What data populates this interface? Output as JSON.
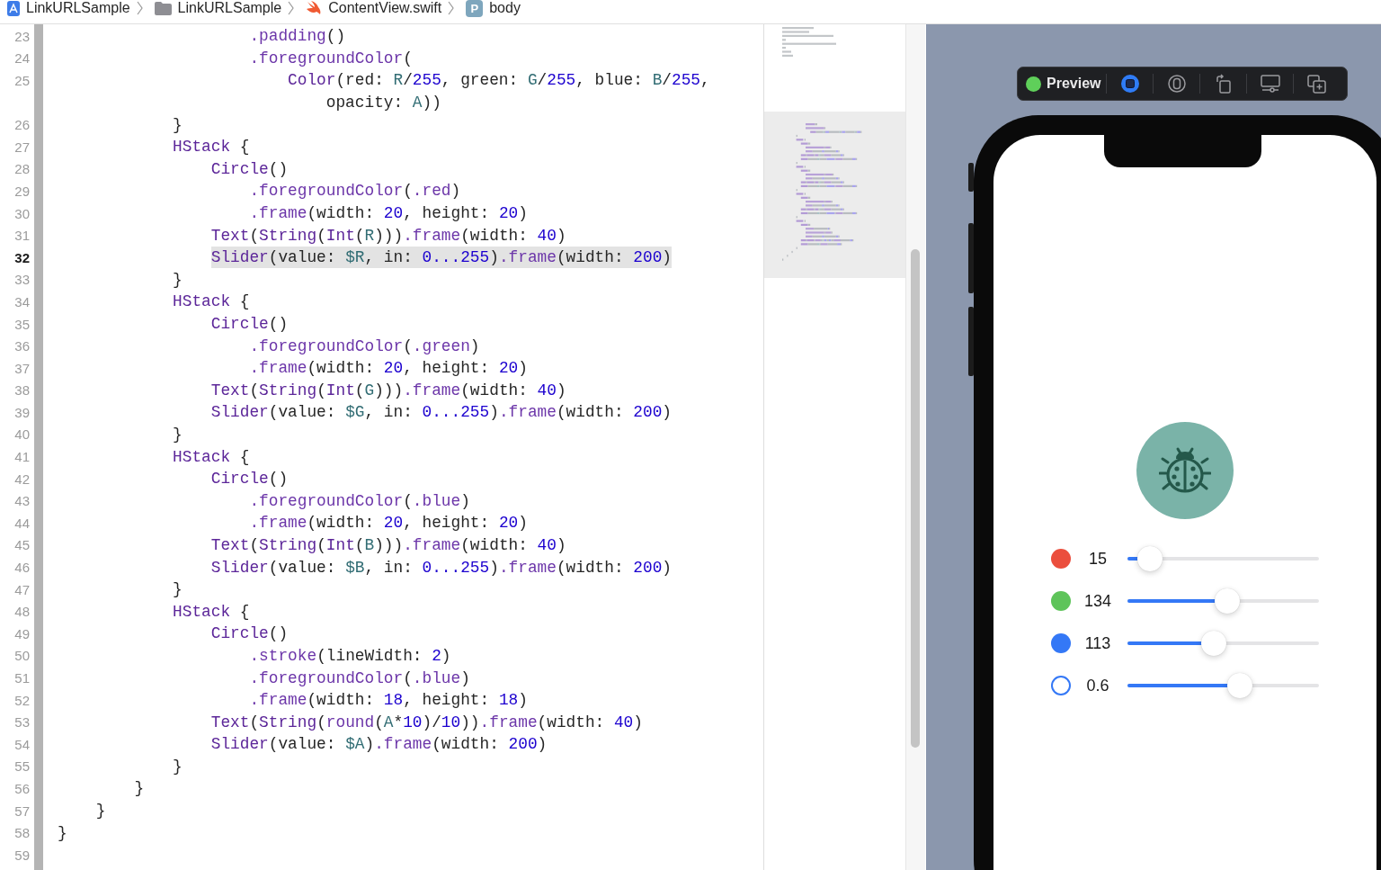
{
  "breadcrumb": [
    {
      "kind": "app",
      "label": "LinkURLSample"
    },
    {
      "kind": "folder",
      "label": "LinkURLSample"
    },
    {
      "kind": "swift",
      "label": "ContentView.swift"
    },
    {
      "kind": "property",
      "badge": "P",
      "label": "body"
    }
  ],
  "editor": {
    "lines": [
      {
        "number": "23",
        "current": false,
        "segments": [
          {
            "kind": "member",
            "text": "                    .padding"
          },
          {
            "kind": "plain",
            "text": "()"
          }
        ]
      },
      {
        "number": "24",
        "current": false,
        "segments": [
          {
            "kind": "member",
            "text": "                    .foregroundColor"
          },
          {
            "kind": "plain",
            "text": "("
          }
        ]
      },
      {
        "number": "25",
        "current": false,
        "segments": [
          {
            "kind": "type",
            "text": "                        Color"
          },
          {
            "kind": "plain",
            "text": "(red: "
          },
          {
            "kind": "variable",
            "text": "R"
          },
          {
            "kind": "plain",
            "text": "/"
          },
          {
            "kind": "number",
            "text": "255"
          },
          {
            "kind": "plain",
            "text": ", green: "
          },
          {
            "kind": "variable",
            "text": "G"
          },
          {
            "kind": "plain",
            "text": "/"
          },
          {
            "kind": "number",
            "text": "255"
          },
          {
            "kind": "plain",
            "text": ", blue: "
          },
          {
            "kind": "variable",
            "text": "B"
          },
          {
            "kind": "plain",
            "text": "/"
          },
          {
            "kind": "number",
            "text": "255"
          },
          {
            "kind": "plain",
            "text": ","
          }
        ],
        "continued": [
          {
            "kind": "plain",
            "text": "                            opacity: "
          },
          {
            "kind": "variable",
            "text": "A"
          },
          {
            "kind": "plain",
            "text": "))"
          }
        ]
      },
      {
        "number": "26",
        "current": false,
        "segments": [
          {
            "kind": "plain",
            "text": "            }"
          }
        ]
      },
      {
        "number": "27",
        "current": false,
        "segments": [
          {
            "kind": "type",
            "text": "            HStack"
          },
          {
            "kind": "plain",
            "text": " {"
          }
        ]
      },
      {
        "number": "28",
        "current": false,
        "segments": [
          {
            "kind": "type",
            "text": "                Circle"
          },
          {
            "kind": "plain",
            "text": "()"
          }
        ]
      },
      {
        "number": "29",
        "current": false,
        "segments": [
          {
            "kind": "member",
            "text": "                    .foregroundColor"
          },
          {
            "kind": "plain",
            "text": "("
          },
          {
            "kind": "member",
            "text": ".red"
          },
          {
            "kind": "plain",
            "text": ")"
          }
        ]
      },
      {
        "number": "30",
        "current": false,
        "segments": [
          {
            "kind": "member",
            "text": "                    .frame"
          },
          {
            "kind": "plain",
            "text": "(width: "
          },
          {
            "kind": "number",
            "text": "20"
          },
          {
            "kind": "plain",
            "text": ", height: "
          },
          {
            "kind": "number",
            "text": "20"
          },
          {
            "kind": "plain",
            "text": ")"
          }
        ]
      },
      {
        "number": "31",
        "current": false,
        "segments": [
          {
            "kind": "type",
            "text": "                Text"
          },
          {
            "kind": "plain",
            "text": "("
          },
          {
            "kind": "type",
            "text": "String"
          },
          {
            "kind": "plain",
            "text": "("
          },
          {
            "kind": "type",
            "text": "Int"
          },
          {
            "kind": "plain",
            "text": "("
          },
          {
            "kind": "variable",
            "text": "R"
          },
          {
            "kind": "plain",
            "text": ")))"
          },
          {
            "kind": "member",
            "text": ".frame"
          },
          {
            "kind": "plain",
            "text": "(width: "
          },
          {
            "kind": "number",
            "text": "40"
          },
          {
            "kind": "plain",
            "text": ")"
          }
        ]
      },
      {
        "number": "32",
        "current": true,
        "segments": [
          {
            "kind": "type",
            "text": "                Slider"
          },
          {
            "kind": "plain",
            "text": "(value: "
          },
          {
            "kind": "variable",
            "text": "$R"
          },
          {
            "kind": "plain",
            "text": ", in: "
          },
          {
            "kind": "number",
            "text": "0...255"
          },
          {
            "kind": "plain",
            "text": ")"
          },
          {
            "kind": "member",
            "text": ".frame"
          },
          {
            "kind": "plain",
            "text": "(width: "
          },
          {
            "kind": "number",
            "text": "200"
          },
          {
            "kind": "plain",
            "text": ")"
          }
        ]
      },
      {
        "number": "33",
        "current": false,
        "segments": [
          {
            "kind": "plain",
            "text": "            }"
          }
        ]
      },
      {
        "number": "34",
        "current": false,
        "segments": [
          {
            "kind": "type",
            "text": "            HStack"
          },
          {
            "kind": "plain",
            "text": " {"
          }
        ]
      },
      {
        "number": "35",
        "current": false,
        "segments": [
          {
            "kind": "type",
            "text": "                Circle"
          },
          {
            "kind": "plain",
            "text": "()"
          }
        ]
      },
      {
        "number": "36",
        "current": false,
        "segments": [
          {
            "kind": "member",
            "text": "                    .foregroundColor"
          },
          {
            "kind": "plain",
            "text": "("
          },
          {
            "kind": "member",
            "text": ".green"
          },
          {
            "kind": "plain",
            "text": ")"
          }
        ]
      },
      {
        "number": "37",
        "current": false,
        "segments": [
          {
            "kind": "member",
            "text": "                    .frame"
          },
          {
            "kind": "plain",
            "text": "(width: "
          },
          {
            "kind": "number",
            "text": "20"
          },
          {
            "kind": "plain",
            "text": ", height: "
          },
          {
            "kind": "number",
            "text": "20"
          },
          {
            "kind": "plain",
            "text": ")"
          }
        ]
      },
      {
        "number": "38",
        "current": false,
        "segments": [
          {
            "kind": "type",
            "text": "                Text"
          },
          {
            "kind": "plain",
            "text": "("
          },
          {
            "kind": "type",
            "text": "String"
          },
          {
            "kind": "plain",
            "text": "("
          },
          {
            "kind": "type",
            "text": "Int"
          },
          {
            "kind": "plain",
            "text": "("
          },
          {
            "kind": "variable",
            "text": "G"
          },
          {
            "kind": "plain",
            "text": ")))"
          },
          {
            "kind": "member",
            "text": ".frame"
          },
          {
            "kind": "plain",
            "text": "(width: "
          },
          {
            "kind": "number",
            "text": "40"
          },
          {
            "kind": "plain",
            "text": ")"
          }
        ]
      },
      {
        "number": "39",
        "current": false,
        "segments": [
          {
            "kind": "type",
            "text": "                Slider"
          },
          {
            "kind": "plain",
            "text": "(value: "
          },
          {
            "kind": "variable",
            "text": "$G"
          },
          {
            "kind": "plain",
            "text": ", in: "
          },
          {
            "kind": "number",
            "text": "0...255"
          },
          {
            "kind": "plain",
            "text": ")"
          },
          {
            "kind": "member",
            "text": ".frame"
          },
          {
            "kind": "plain",
            "text": "(width: "
          },
          {
            "kind": "number",
            "text": "200"
          },
          {
            "kind": "plain",
            "text": ")"
          }
        ]
      },
      {
        "number": "40",
        "current": false,
        "segments": [
          {
            "kind": "plain",
            "text": "            }"
          }
        ]
      },
      {
        "number": "41",
        "current": false,
        "segments": [
          {
            "kind": "type",
            "text": "            HStack"
          },
          {
            "kind": "plain",
            "text": " {"
          }
        ]
      },
      {
        "number": "42",
        "current": false,
        "segments": [
          {
            "kind": "type",
            "text": "                Circle"
          },
          {
            "kind": "plain",
            "text": "()"
          }
        ]
      },
      {
        "number": "43",
        "current": false,
        "segments": [
          {
            "kind": "member",
            "text": "                    .foregroundColor"
          },
          {
            "kind": "plain",
            "text": "("
          },
          {
            "kind": "member",
            "text": ".blue"
          },
          {
            "kind": "plain",
            "text": ")"
          }
        ]
      },
      {
        "number": "44",
        "current": false,
        "segments": [
          {
            "kind": "member",
            "text": "                    .frame"
          },
          {
            "kind": "plain",
            "text": "(width: "
          },
          {
            "kind": "number",
            "text": "20"
          },
          {
            "kind": "plain",
            "text": ", height: "
          },
          {
            "kind": "number",
            "text": "20"
          },
          {
            "kind": "plain",
            "text": ")"
          }
        ]
      },
      {
        "number": "45",
        "current": false,
        "segments": [
          {
            "kind": "type",
            "text": "                Text"
          },
          {
            "kind": "plain",
            "text": "("
          },
          {
            "kind": "type",
            "text": "String"
          },
          {
            "kind": "plain",
            "text": "("
          },
          {
            "kind": "type",
            "text": "Int"
          },
          {
            "kind": "plain",
            "text": "("
          },
          {
            "kind": "variable",
            "text": "B"
          },
          {
            "kind": "plain",
            "text": ")))"
          },
          {
            "kind": "member",
            "text": ".frame"
          },
          {
            "kind": "plain",
            "text": "(width: "
          },
          {
            "kind": "number",
            "text": "40"
          },
          {
            "kind": "plain",
            "text": ")"
          }
        ]
      },
      {
        "number": "46",
        "current": false,
        "segments": [
          {
            "kind": "type",
            "text": "                Slider"
          },
          {
            "kind": "plain",
            "text": "(value: "
          },
          {
            "kind": "variable",
            "text": "$B"
          },
          {
            "kind": "plain",
            "text": ", in: "
          },
          {
            "kind": "number",
            "text": "0...255"
          },
          {
            "kind": "plain",
            "text": ")"
          },
          {
            "kind": "member",
            "text": ".frame"
          },
          {
            "kind": "plain",
            "text": "(width: "
          },
          {
            "kind": "number",
            "text": "200"
          },
          {
            "kind": "plain",
            "text": ")"
          }
        ]
      },
      {
        "number": "47",
        "current": false,
        "segments": [
          {
            "kind": "plain",
            "text": "            }"
          }
        ]
      },
      {
        "number": "48",
        "current": false,
        "segments": [
          {
            "kind": "type",
            "text": "            HStack"
          },
          {
            "kind": "plain",
            "text": " {"
          }
        ]
      },
      {
        "number": "49",
        "current": false,
        "segments": [
          {
            "kind": "type",
            "text": "                Circle"
          },
          {
            "kind": "plain",
            "text": "()"
          }
        ]
      },
      {
        "number": "50",
        "current": false,
        "segments": [
          {
            "kind": "member",
            "text": "                    .stroke"
          },
          {
            "kind": "plain",
            "text": "(lineWidth: "
          },
          {
            "kind": "number",
            "text": "2"
          },
          {
            "kind": "plain",
            "text": ")"
          }
        ]
      },
      {
        "number": "51",
        "current": false,
        "segments": [
          {
            "kind": "member",
            "text": "                    .foregroundColor"
          },
          {
            "kind": "plain",
            "text": "("
          },
          {
            "kind": "member",
            "text": ".blue"
          },
          {
            "kind": "plain",
            "text": ")"
          }
        ]
      },
      {
        "number": "52",
        "current": false,
        "segments": [
          {
            "kind": "member",
            "text": "                    .frame"
          },
          {
            "kind": "plain",
            "text": "(width: "
          },
          {
            "kind": "number",
            "text": "18"
          },
          {
            "kind": "plain",
            "text": ", height: "
          },
          {
            "kind": "number",
            "text": "18"
          },
          {
            "kind": "plain",
            "text": ")"
          }
        ]
      },
      {
        "number": "53",
        "current": false,
        "segments": [
          {
            "kind": "type",
            "text": "                Text"
          },
          {
            "kind": "plain",
            "text": "("
          },
          {
            "kind": "type",
            "text": "String"
          },
          {
            "kind": "plain",
            "text": "("
          },
          {
            "kind": "member",
            "text": "round"
          },
          {
            "kind": "plain",
            "text": "("
          },
          {
            "kind": "variable",
            "text": "A"
          },
          {
            "kind": "plain",
            "text": "*"
          },
          {
            "kind": "number",
            "text": "10"
          },
          {
            "kind": "plain",
            "text": ")/"
          },
          {
            "kind": "number",
            "text": "10"
          },
          {
            "kind": "plain",
            "text": "))"
          },
          {
            "kind": "member",
            "text": ".frame"
          },
          {
            "kind": "plain",
            "text": "(width: "
          },
          {
            "kind": "number",
            "text": "40"
          },
          {
            "kind": "plain",
            "text": ")"
          }
        ]
      },
      {
        "number": "54",
        "current": false,
        "segments": [
          {
            "kind": "type",
            "text": "                Slider"
          },
          {
            "kind": "plain",
            "text": "(value: "
          },
          {
            "kind": "variable",
            "text": "$A"
          },
          {
            "kind": "plain",
            "text": ")"
          },
          {
            "kind": "member",
            "text": ".frame"
          },
          {
            "kind": "plain",
            "text": "(width: "
          },
          {
            "kind": "number",
            "text": "200"
          },
          {
            "kind": "plain",
            "text": ")"
          }
        ]
      },
      {
        "number": "55",
        "current": false,
        "segments": [
          {
            "kind": "plain",
            "text": "            }"
          }
        ]
      },
      {
        "number": "56",
        "current": false,
        "segments": [
          {
            "kind": "plain",
            "text": "        }"
          }
        ]
      },
      {
        "number": "57",
        "current": false,
        "segments": [
          {
            "kind": "plain",
            "text": "    }"
          }
        ]
      },
      {
        "number": "58",
        "current": false,
        "segments": [
          {
            "kind": "plain",
            "text": "}"
          }
        ]
      },
      {
        "number": "59",
        "current": false
      }
    ]
  },
  "preview": {
    "toolbar": {
      "label": "Preview",
      "buttons": [
        {
          "kind": "live",
          "selected": true
        },
        {
          "kind": "selectable",
          "selected": false
        },
        {
          "kind": "rotate"
        },
        {
          "kind": "device"
        },
        {
          "kind": "duplicate"
        }
      ]
    },
    "rows": [
      {
        "kind": "filled",
        "color": "#eb4e3d",
        "value": "15",
        "level": 0.059
      },
      {
        "kind": "filled",
        "color": "#5ec45a",
        "value": "134",
        "level": 0.525
      },
      {
        "kind": "filled",
        "color": "#3478f6",
        "value": "113",
        "level": 0.443
      },
      {
        "kind": "ring",
        "color": "#3478f6",
        "value": "0.6",
        "level": 0.6
      }
    ]
  }
}
